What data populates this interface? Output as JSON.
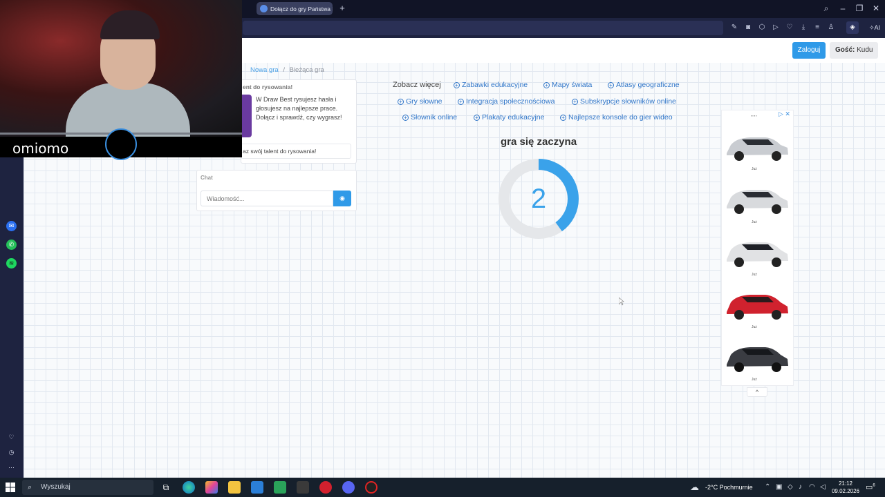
{
  "browser": {
    "tab_title": "Dołącz do gry Państwa M",
    "new_tab": "+",
    "window_controls": {
      "search": "⌕",
      "minimize": "–",
      "restore": "❐",
      "close": "✕"
    },
    "ai_label": "AI",
    "toolbar_icons": [
      "edit-icon",
      "camera-icon",
      "shield-icon",
      "play-icon",
      "heart-icon",
      "download-icon",
      "menu-icon",
      "user-icon"
    ]
  },
  "header": {
    "login_label": "Zaloguj",
    "guest_prefix": "Gość:",
    "guest_name": "Kudu"
  },
  "breadcrumb": {
    "item1": "Nowa gra",
    "separator": "/",
    "item2": "Bieżąca gra"
  },
  "info_card": {
    "heading": "ent do rysowania!",
    "text": "W Draw Best rysujesz hasła i głosujesz na najlepsze prace. Dołącz i sprawdź, czy wygrasz!",
    "talent_text": "az swój talent do rysowania!"
  },
  "chat": {
    "title": "Chat",
    "placeholder": "Wiadomość..."
  },
  "see_more": {
    "label": "Zobacz więcej",
    "tags": [
      "Zabawki edukacyjne",
      "Mapy świata",
      "Atlasy geograficzne",
      "Gry słowne",
      "Integracja społecznościowa",
      "Subskrypcje słowników online",
      "Słownik online",
      "Plakaty edukacyjne",
      "Najlepsze konsole do gier wideo"
    ]
  },
  "game": {
    "status": "gra się zaczyna",
    "countdown": "2",
    "countdown_progress": 0.4
  },
  "ad": {
    "car_label": "Już",
    "toggle": "^",
    "close": "▷ ✕"
  },
  "webcam": {
    "name": "omiomo"
  },
  "taskbar": {
    "search_label": "Wyszukaj",
    "weather_temp": "-2°C",
    "weather_desc": "Pochmurnie",
    "time": "21:12",
    "date": "09.02.2026",
    "notification_count": "6"
  },
  "colors": {
    "accent": "#2f9ae8",
    "countdown": "#3aa2ea",
    "link": "#2f75c8"
  }
}
